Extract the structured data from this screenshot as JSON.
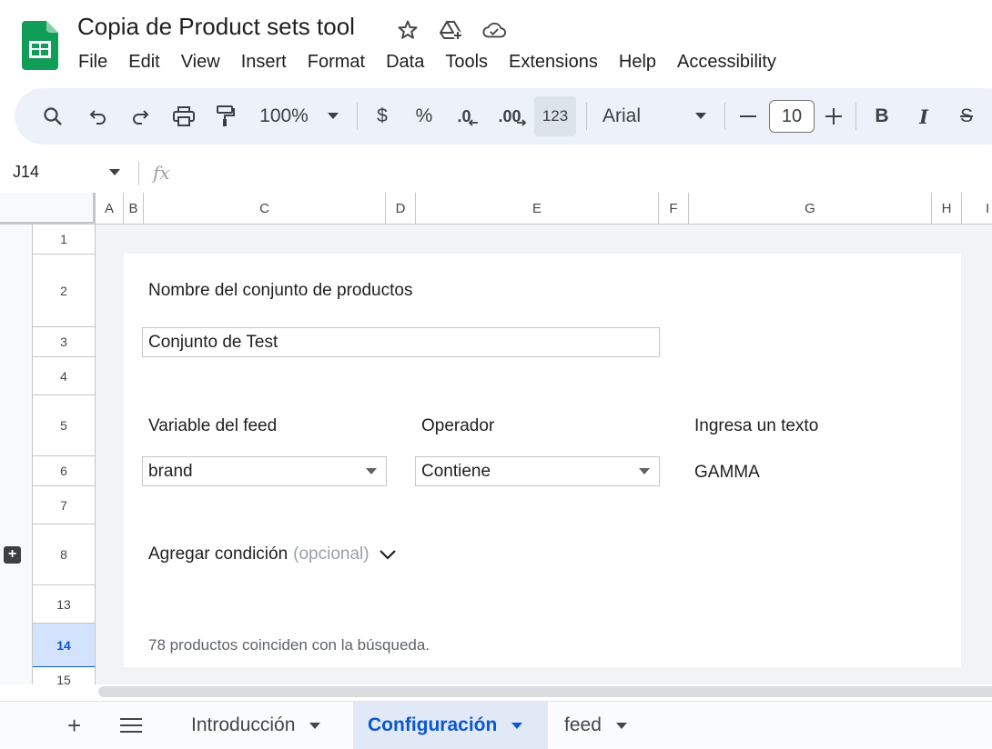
{
  "app": {
    "title": "Copia de Product sets tool",
    "menu": [
      "File",
      "Edit",
      "View",
      "Insert",
      "Format",
      "Data",
      "Tools",
      "Extensions",
      "Help",
      "Accessibility"
    ]
  },
  "toolbar": {
    "zoom": "100%",
    "currency": "$",
    "percent": "%",
    "decrease_decimal": ".0",
    "increase_decimal": ".00",
    "format_123": "123",
    "font": "Arial",
    "font_size": "10",
    "bold": "B",
    "italic": "I",
    "strike": "S"
  },
  "formula_bar": {
    "cell_ref": "J14",
    "fx": "fx",
    "value": ""
  },
  "columns": [
    "A",
    "B",
    "C",
    "D",
    "E",
    "F",
    "G",
    "H",
    "I"
  ],
  "rows": [
    "1",
    "2",
    "3",
    "4",
    "5",
    "6",
    "7",
    "8",
    "13",
    "14",
    "15"
  ],
  "selected_row": "14",
  "form": {
    "set_name_label": "Nombre del conjunto de productos",
    "set_name_value": "Conjunto de Test",
    "variable_label": "Variable del feed",
    "variable_value": "brand",
    "operator_label": "Operador",
    "operator_value": "Contiene",
    "text_label": "Ingresa un texto",
    "text_value": "GAMMA",
    "add_condition": "Agregar condición",
    "add_condition_optional": "(opcional)",
    "result": "78 productos coinciden con la búsqueda."
  },
  "sheets": {
    "add": "+",
    "tabs": [
      "Introducción",
      "Configuración",
      "feed"
    ],
    "active": "Configuración"
  },
  "colors": {
    "accent": "#0b57d0",
    "toolbar_bg": "#edf2fa",
    "sheets_green": "#0f9d58",
    "selected_row_bg": "#d3e3fd"
  }
}
